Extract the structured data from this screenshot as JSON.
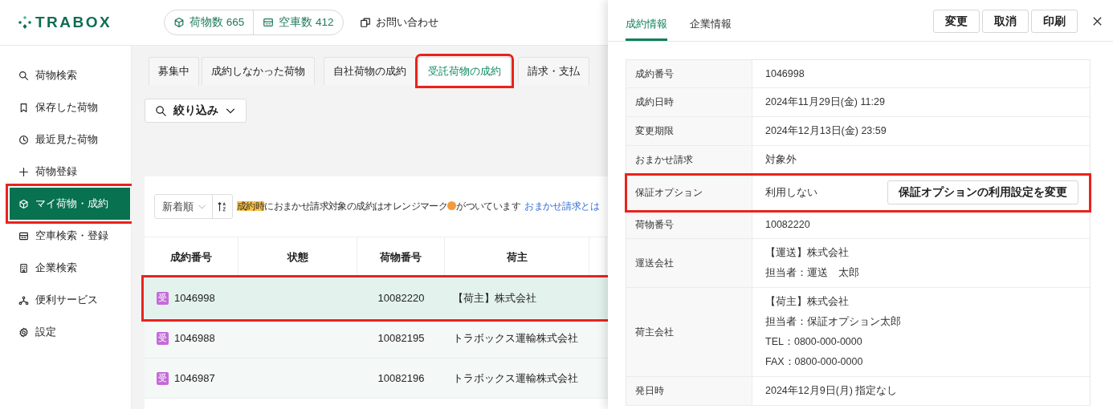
{
  "logo": "TRABOX",
  "header": {
    "counts": [
      {
        "kind": "cargo",
        "label": "荷物数 665"
      },
      {
        "kind": "truck",
        "label": "空車数 412"
      }
    ],
    "contact_link": "お問い合わせ"
  },
  "sidebar": {
    "items": [
      {
        "kind": "search",
        "label": "荷物検索",
        "selected": false,
        "highlighted": false
      },
      {
        "kind": "bookmark",
        "label": "保存した荷物",
        "selected": false,
        "highlighted": false
      },
      {
        "kind": "clock",
        "label": "最近見た荷物",
        "selected": false,
        "highlighted": false
      },
      {
        "kind": "plus",
        "label": "荷物登録",
        "selected": false,
        "highlighted": false
      },
      {
        "kind": "cube",
        "label": "マイ荷物・成約",
        "selected": true,
        "highlighted": true
      },
      {
        "kind": "truck",
        "label": "空車検索・登録",
        "selected": false,
        "highlighted": false
      },
      {
        "kind": "building",
        "label": "企業検索",
        "selected": false,
        "highlighted": false
      },
      {
        "kind": "nodes",
        "label": "便利サービス",
        "selected": false,
        "highlighted": false
      },
      {
        "kind": "gear",
        "label": "設定",
        "selected": false,
        "highlighted": false
      }
    ]
  },
  "tabs": [
    {
      "label": "募集中",
      "selected": false,
      "highlighted": false
    },
    {
      "label": "成約しなかった荷物",
      "selected": false,
      "highlighted": false
    },
    {
      "label": "自社荷物の成約",
      "selected": false,
      "highlighted": false
    },
    {
      "label": "受託荷物の成約",
      "selected": true,
      "highlighted": true
    },
    {
      "label": "請求・支払",
      "selected": false,
      "highlighted": false
    }
  ],
  "filter_button": "絞り込み",
  "sort": {
    "value": "新着順"
  },
  "notice": {
    "highlight": "成約時",
    "before_dot": "におまかせ請求対象の成約はオレンジマーク",
    "after_dot": "がついています",
    "link": "おまかせ請求とは"
  },
  "table": {
    "columns": [
      "成約番号",
      "状態",
      "荷物番号",
      "荷主"
    ],
    "rows": [
      {
        "badge": "受",
        "contract_no": "1046998",
        "cargo_no": "10082220",
        "shipper": "【荷主】株式会社",
        "selected": true,
        "highlighted": true
      },
      {
        "badge": "受",
        "contract_no": "1046988",
        "cargo_no": "10082195",
        "shipper": "トラボックス運輸株式会社",
        "selected": false,
        "highlighted": false
      },
      {
        "badge": "受",
        "contract_no": "1046987",
        "cargo_no": "10082196",
        "shipper": "トラボックス運輸株式会社",
        "selected": false,
        "highlighted": false
      }
    ]
  },
  "drawer": {
    "tabs": [
      {
        "label": "成約情報",
        "selected": true
      },
      {
        "label": "企業情報",
        "selected": false
      }
    ],
    "buttons": [
      "変更",
      "取消",
      "印刷"
    ],
    "details": [
      {
        "label": "成約番号",
        "lines": [
          "1046998"
        ],
        "highlighted": false
      },
      {
        "label": "成約日時",
        "lines": [
          "2024年11月29日(金) 11:29"
        ],
        "highlighted": false
      },
      {
        "label": "変更期限",
        "lines": [
          "2024年12月13日(金) 23:59"
        ],
        "highlighted": false
      },
      {
        "label": "おまかせ請求",
        "lines": [
          "対象外"
        ],
        "highlighted": false
      },
      {
        "label": "保証オプション",
        "lines": [
          "利用しない"
        ],
        "button": "保証オプションの利用設定を変更",
        "highlighted": true
      },
      {
        "label": "荷物番号",
        "lines": [
          "10082220"
        ],
        "highlighted": false
      },
      {
        "label": "運送会社",
        "lines": [
          "【運送】株式会社",
          "担当者：運送　太郎"
        ],
        "highlighted": false
      },
      {
        "label": "荷主会社",
        "lines": [
          "【荷主】株式会社",
          "担当者：保証オプション太郎",
          "TEL：0800-000-0000",
          "FAX：0800-000-0000"
        ],
        "highlighted": false
      },
      {
        "label": "発日時",
        "lines": [
          "2024年12月9日(月) 指定なし"
        ],
        "highlighted": false
      }
    ]
  }
}
